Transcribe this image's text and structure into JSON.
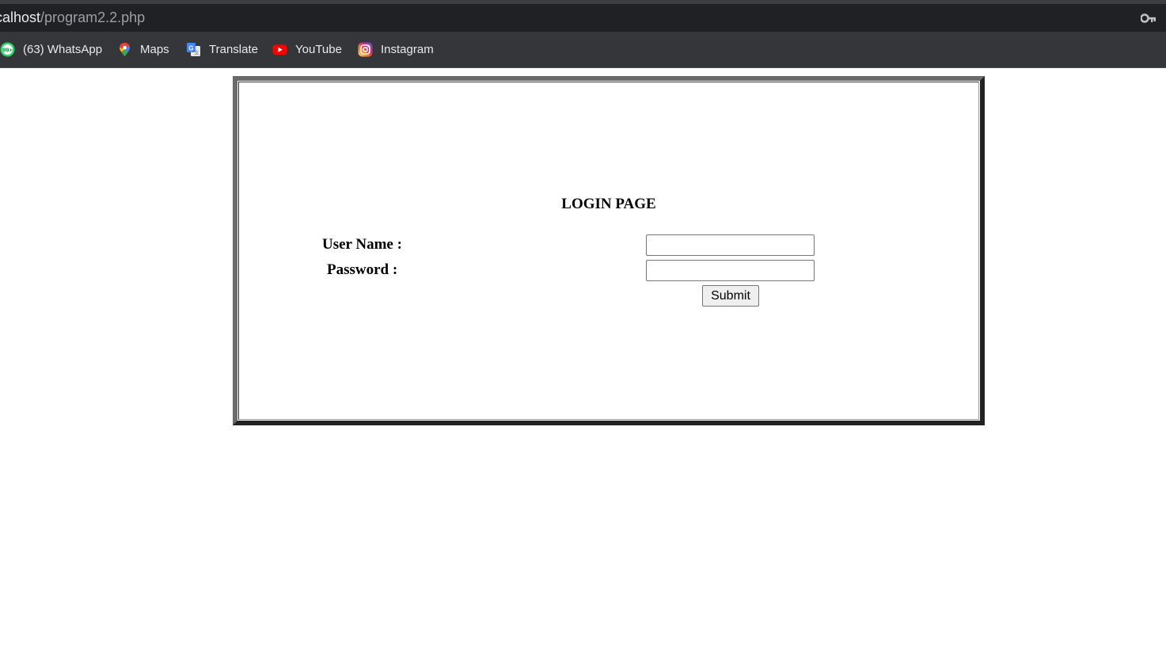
{
  "browser": {
    "url_host": "calhost",
    "url_path": "/program2.2.php",
    "bookmarks": [
      {
        "label": "(63) WhatsApp",
        "icon": "whatsapp-icon"
      },
      {
        "label": "Maps",
        "icon": "maps-icon"
      },
      {
        "label": "Translate",
        "icon": "translate-icon"
      },
      {
        "label": "YouTube",
        "icon": "youtube-icon"
      },
      {
        "label": "Instagram",
        "icon": "instagram-icon"
      }
    ],
    "whatsapp_badge": "99+"
  },
  "login": {
    "title": "LOGIN PAGE",
    "username_label": "User Name :",
    "password_label": "Password :",
    "username_value": "",
    "password_value": "",
    "submit_label": "Submit"
  },
  "colors": {
    "chrome_dark": "#202124",
    "bookmark_bar": "#35363a",
    "youtube_red": "#ff0000",
    "whatsapp_green": "#25d366"
  }
}
